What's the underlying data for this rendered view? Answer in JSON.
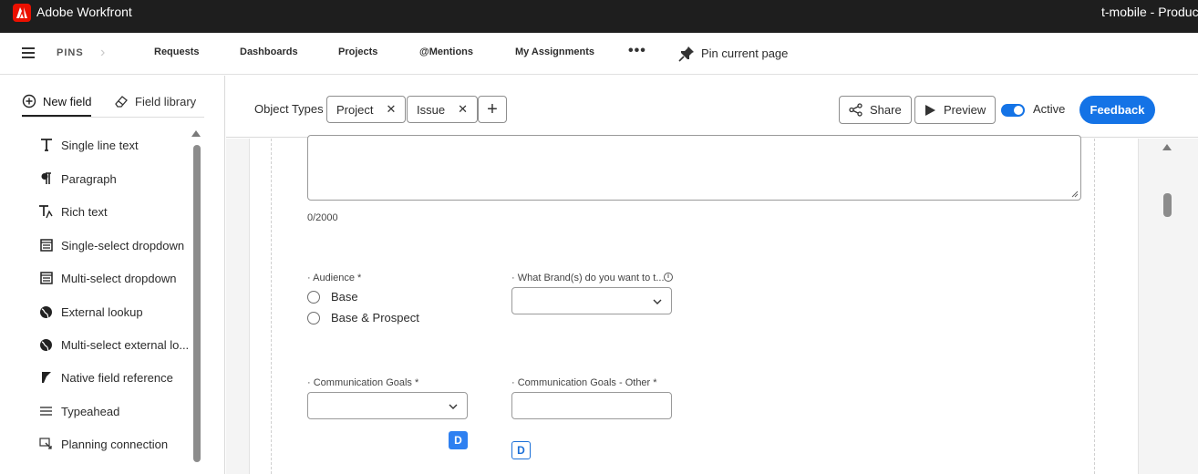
{
  "window": {
    "app_title": "Adobe Workfront",
    "right_title": "t-mobile - Productio"
  },
  "topnav": {
    "pins_label": "PINS",
    "links": [
      "Requests",
      "Dashboards",
      "Projects",
      "@Mentions",
      "My Assignments"
    ],
    "more_label": "•••",
    "pin_current_label": "Pin current page"
  },
  "left_panel": {
    "tabs": {
      "new_field": "New field",
      "field_library": "Field library"
    },
    "field_types": [
      {
        "label": "Single line text",
        "icon": "text-icon"
      },
      {
        "label": "Paragraph",
        "icon": "paragraph-icon"
      },
      {
        "label": "Rich text",
        "icon": "rich-text-icon"
      },
      {
        "label": "Single-select dropdown",
        "icon": "dropdown-icon"
      },
      {
        "label": "Multi-select dropdown",
        "icon": "multi-dropdown-icon"
      },
      {
        "label": "External lookup",
        "icon": "globe-icon"
      },
      {
        "label": "Multi-select external lo...",
        "icon": "globe-icon"
      },
      {
        "label": "Native field reference",
        "icon": "reference-icon"
      },
      {
        "label": "Typeahead",
        "icon": "typeahead-icon"
      },
      {
        "label": "Planning connection",
        "icon": "connection-icon"
      }
    ]
  },
  "header": {
    "object_types_label": "Object Types",
    "object_types": [
      "Project",
      "Issue"
    ],
    "add_label": "+",
    "share_label": "Share",
    "preview_label": "Preview",
    "active_label": "Active",
    "active_on": true,
    "feedback_label": "Feedback",
    "accent_color": "#1473e6"
  },
  "form": {
    "char_count": "0/2000",
    "audience": {
      "label": "· Audience *",
      "options": [
        "Base",
        "Base & Prospect"
      ]
    },
    "brand": {
      "label": "· What Brand(s) do you want to t...",
      "info": "i"
    },
    "comm_goals": {
      "label": "· Communication Goals *",
      "badge": "D"
    },
    "comm_goals_other": {
      "label": "· Communication Goals - Other *",
      "badge": "D"
    }
  }
}
